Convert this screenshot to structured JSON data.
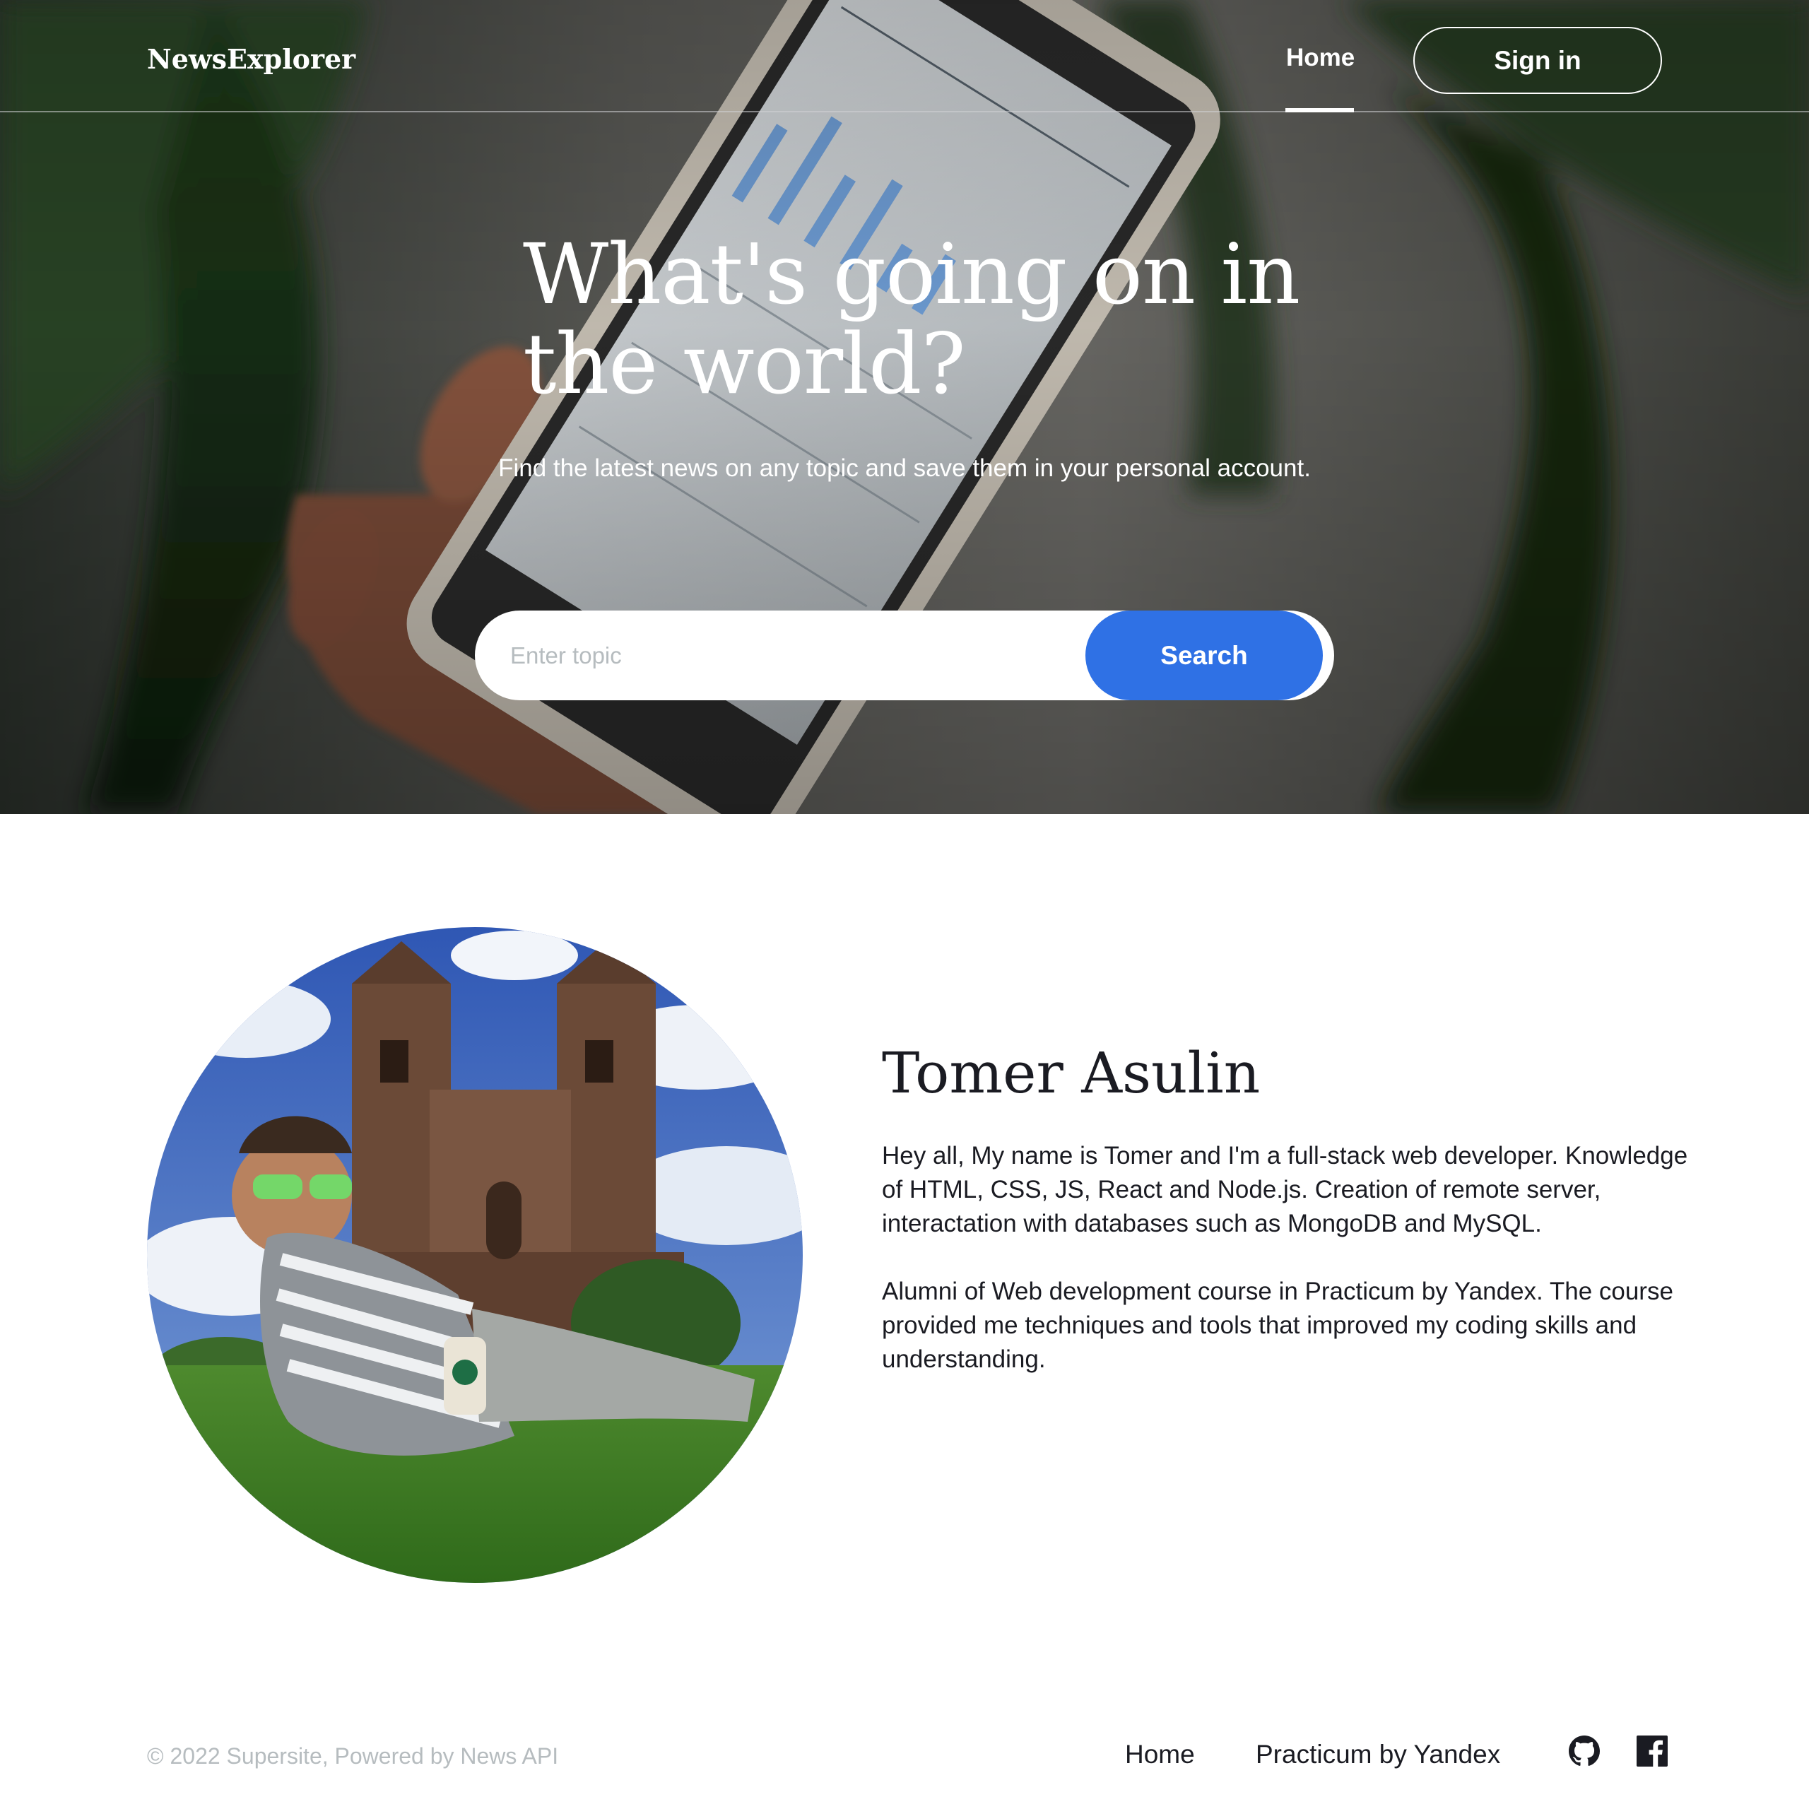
{
  "header": {
    "logo": "NewsExplorer",
    "nav_home": "Home",
    "signin_label": "Sign in"
  },
  "hero": {
    "title": "What's going on in the world?",
    "subtitle": "Find the latest news on any topic and save them in your personal account.",
    "search": {
      "placeholder": "Enter topic",
      "value": "",
      "button_label": "Search"
    }
  },
  "about": {
    "name": "Tomer Asulin",
    "paragraph_1": "Hey all, My name is Tomer and I'm a full-stack web developer. Knowledge of HTML, CSS, JS, React and Node.js. Creation of remote server, interactation with databases such as MongoDB and MySQL.",
    "paragraph_2": "Alumni of Web development course in Practicum by Yandex. The course provided me techniques and tools that improved my coding skills and understanding."
  },
  "footer": {
    "copyright": "© 2022 Supersite, Powered by News API",
    "links": [
      "Home",
      "Practicum by Yandex"
    ],
    "icons": [
      "github-icon",
      "facebook-icon"
    ]
  },
  "colors": {
    "accent": "#2f71e5",
    "text_dark": "#1a1b22",
    "text_muted": "#b6bcbf",
    "white": "#ffffff"
  }
}
